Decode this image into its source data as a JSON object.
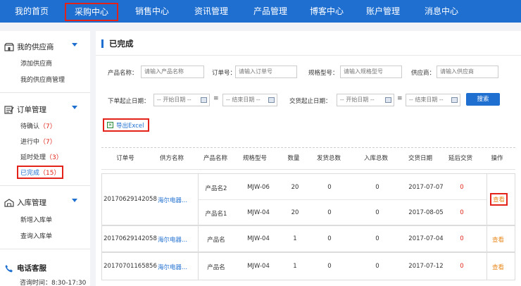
{
  "nav": {
    "items": [
      {
        "label": "我的首页"
      },
      {
        "label": "采购中心"
      },
      {
        "label": "销售中心"
      },
      {
        "label": "资讯管理"
      },
      {
        "label": "产品管理"
      },
      {
        "label": "博客中心"
      },
      {
        "label": "账户管理"
      },
      {
        "label": "消息中心"
      }
    ],
    "active_index": 1
  },
  "sidebar": {
    "supplier": {
      "title": "我的供应商",
      "links": [
        "添加供应商",
        "我的供应商管理"
      ]
    },
    "order": {
      "title": "订单管理",
      "links": [
        {
          "label": "待确认",
          "count": "（7）"
        },
        {
          "label": "进行中",
          "count": "（7）"
        },
        {
          "label": "延时处理",
          "count": "（3）"
        },
        {
          "label": "已完成",
          "count": "（15）"
        }
      ]
    },
    "stock": {
      "title": "入库管理",
      "links": [
        "新增入库单",
        "查询入库单"
      ]
    },
    "service": {
      "title": "电话客服",
      "hours": "咨询时间：8:30-17:30"
    }
  },
  "panel": {
    "title": "已完成"
  },
  "filters": {
    "product_name": {
      "label": "产品名称：",
      "placeholder": "请输入产品名称"
    },
    "order_no": {
      "label": "订单号：",
      "placeholder": "请输入订单号"
    },
    "spec": {
      "label": "规格型号：",
      "placeholder": "请输入规格型号"
    },
    "supplier": {
      "label": "供应商：",
      "placeholder": "请输入供应商"
    },
    "order_date": {
      "label": "下单起止日期：",
      "start_placeholder": "-- 开始日期 --",
      "end_placeholder": "-- 结束日期 --"
    },
    "delivery_date": {
      "label": "交货起止日期：",
      "start_placeholder": "-- 开始日期 --",
      "end_placeholder": "-- 结束日期 --"
    },
    "search_label": "搜索"
  },
  "export": {
    "label": "导出Excel"
  },
  "table": {
    "headers": [
      "订单号",
      "供方名称",
      "产品名称",
      "规格型号",
      "数量",
      "发货总数",
      "入库总数",
      "交货日期",
      "延后交货",
      "操作"
    ],
    "orders": [
      {
        "order_no": "20170629142058",
        "supplier": "海尔电器...",
        "action": "查看",
        "items": [
          {
            "product": "产品名2",
            "spec": "MJW-06",
            "qty": "20",
            "shipped": "0",
            "stocked": "0",
            "date": "2017-07-07",
            "delay": "0"
          },
          {
            "product": "产品名1",
            "spec": "MJW-04",
            "qty": "20",
            "shipped": "0",
            "stocked": "0",
            "date": "2017-08-05",
            "delay": "0"
          }
        ]
      },
      {
        "order_no": "20170629142058",
        "supplier": "海尔电器...",
        "action": "查看",
        "items": [
          {
            "product": "产品名",
            "spec": "MJW-04",
            "qty": "1",
            "shipped": "0",
            "stocked": "0",
            "date": "2017-07-04",
            "delay": "0"
          }
        ]
      },
      {
        "order_no": "20170701165856",
        "supplier": "海尔电器...",
        "action": "查看",
        "items": [
          {
            "product": "产品名",
            "spec": "MJW-04",
            "qty": "1",
            "shipped": "0",
            "stocked": "0",
            "date": "2017-07-12",
            "delay": "0"
          }
        ]
      }
    ]
  }
}
